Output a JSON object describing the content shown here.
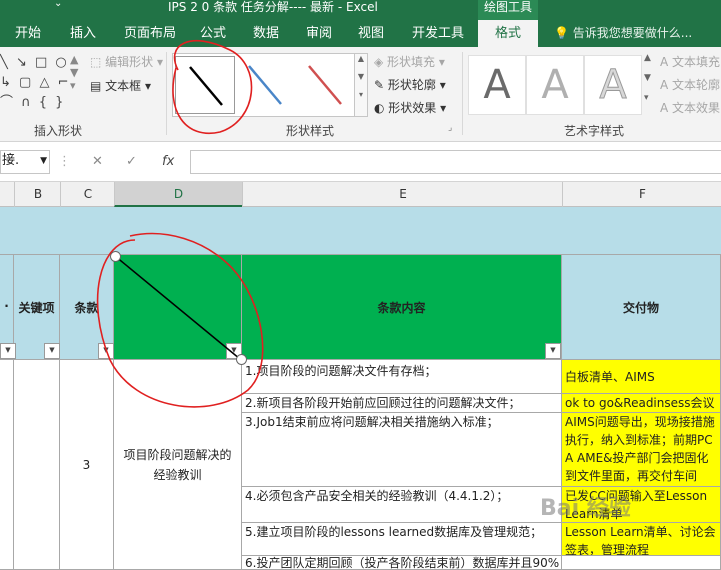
{
  "window": {
    "title": "IPS 2 0 条款 任务分解---- 最新 - Excel",
    "context_tab": "绘图工具"
  },
  "tabs": [
    {
      "label": "开始",
      "active": false
    },
    {
      "label": "插入",
      "active": false
    },
    {
      "label": "页面布局",
      "active": false
    },
    {
      "label": "公式",
      "active": false
    },
    {
      "label": "数据",
      "active": false
    },
    {
      "label": "审阅",
      "active": false
    },
    {
      "label": "视图",
      "active": false
    },
    {
      "label": "开发工具",
      "active": false
    },
    {
      "label": "格式",
      "active": true
    }
  ],
  "tell_me": "告诉我您想要做什么...",
  "ribbon": {
    "insert_shapes": {
      "edit_shape": "编辑形状",
      "text_box": "文本框",
      "label": "插入形状"
    },
    "shape_styles": {
      "fill": "形状填充",
      "outline": "形状轮廓",
      "effects": "形状效果",
      "label": "形状样式",
      "line_colors": [
        "#000000",
        "#4a86c8",
        "#d05050"
      ]
    },
    "wordart": {
      "letter": "A",
      "text_fill": "文本填充",
      "text_outline": "文本轮廓",
      "text_effects": "文本效果",
      "label": "艺术字样式"
    }
  },
  "formula_bar": {
    "name_box": "接.",
    "cancel": "✕",
    "enter": "✓",
    "fx": "fx",
    "value": ""
  },
  "columns": [
    "B",
    "C",
    "D",
    "E",
    "F"
  ],
  "selected_column": "D",
  "header_row": {
    "key_item": "关键项",
    "clause": "条款",
    "content": "条款内容",
    "deliverable": "交付物"
  },
  "clause_number": "3",
  "clause_name": "项目阶段问题解决的经验教训",
  "contents": [
    "1.项目阶段的问题解决文件有存档；",
    "2.新项目各阶段开始前应回顾过往的问题解决文件；",
    "3.Job1结束前应将问题解决相关措施纳入标准；",
    "4.必须包含产品安全相关的经验教训（4.4.1.2）；",
    "5.建立项目阶段的lessons learned数据库及管理规范；",
    "6.投产团队定期回顾（投产各阶段结束前）数据库并且90%"
  ],
  "deliverables": [
    "白板清单、AIMS",
    "ok to go&Readinsess会议",
    "AIMS问题导出，现场接措施执行，纳入到标准；前期PCA AME&投产部门会把固化到文件里面，再交付车间",
    "已发CC问题输入至Lesson Learn清单",
    "Lesson Learn清单、讨论会签表，管理流程",
    ""
  ],
  "watermark": "Bai 经验",
  "colors": {
    "excel_green": "#217346",
    "header_green": "#00b050",
    "yellow": "#ffff00",
    "band": "#b7dde8",
    "annotation_red": "#e02020"
  }
}
